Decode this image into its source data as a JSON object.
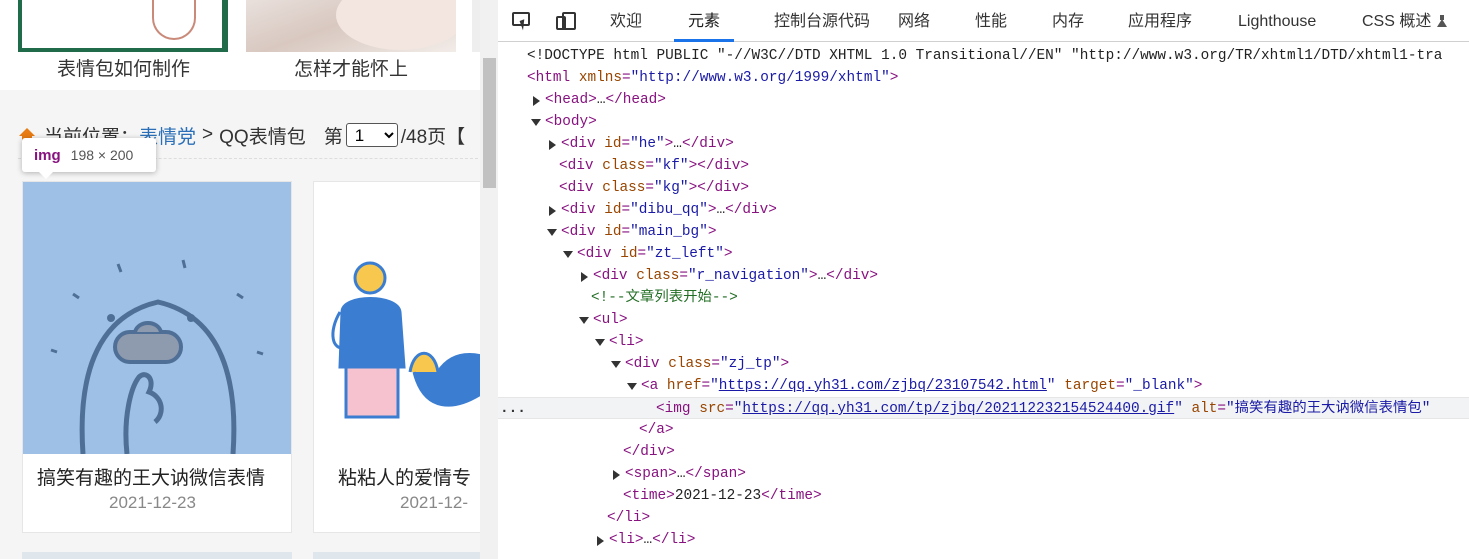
{
  "page": {
    "thumb_captions": [
      "表情包如何制作",
      "怎样才能怀上"
    ],
    "breadcrumb": {
      "prefix": "当前位置：",
      "link": "表情党",
      "sep": ">",
      "current": "QQ表情包",
      "page_label": "第",
      "page_value": "1",
      "page_total": "/48页",
      "bracket": "【"
    },
    "tooltip": {
      "tag": "img",
      "dims": "198 × 200"
    },
    "cards": [
      {
        "title": "搞笑有趣的王大讷微信表情",
        "date": "2021-12-23"
      },
      {
        "title": "粘粘人的爱情专",
        "date": "2021-12-"
      }
    ]
  },
  "devtools": {
    "tabs": [
      "欢迎",
      "元素",
      "控制台",
      "源代码",
      "网络",
      "性能",
      "内存",
      "应用程序",
      "Lighthouse",
      "CSS 概述"
    ],
    "active_tab": "元素",
    "dom": {
      "doctype": "<!DOCTYPE html PUBLIC \"-//W3C//DTD XHTML 1.0 Transitional//EN\" \"http://www.w3.org/TR/xhtml1/DTD/xhtml1-tra",
      "html_attr_val": "\"http://www.w3.org/1999/xhtml\"",
      "id_he": "\"he\"",
      "class_kf": "\"kf\"",
      "class_kg": "\"kg\"",
      "id_dibu": "\"dibu_qq\"",
      "id_main": "\"main_bg\"",
      "id_zt": "\"zt_left\"",
      "class_rnav": "\"r_navigation\"",
      "comment": "<!--文章列表开始-->",
      "class_zjtp": "\"zj_tp\"",
      "a_href": "https://qq.yh31.com/zjbq/23107542.html",
      "a_target": "\"_blank\"",
      "img_src": "https://qq.yh31.com/tp/zjbq/202112232154524400.gif",
      "img_alt": "\"搞笑有趣的王大讷微信表情包\"",
      "time_text": "2021-12-23",
      "ellipsis": "…",
      "sel_dots": "..."
    }
  }
}
